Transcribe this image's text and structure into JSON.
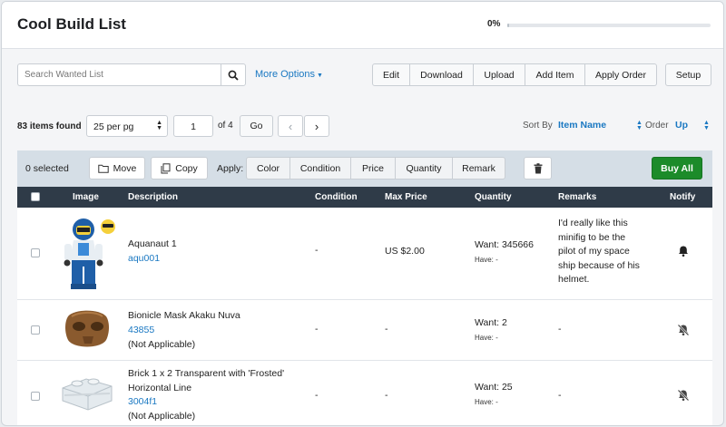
{
  "header": {
    "title": "Cool Build List",
    "progress_text": "0%",
    "progress": 0
  },
  "toolbar": {
    "search_placeholder": "Search Wanted List",
    "search_icon": "magnifier-icon",
    "more_options": "More Options",
    "buttons": [
      "Edit",
      "Download",
      "Upload",
      "Add Item",
      "Apply Order"
    ],
    "setup": "Setup"
  },
  "list": {
    "items_found": "83 items found",
    "per_page": "25 per pg",
    "page": "1",
    "of_pages": "of 4",
    "go": "Go",
    "sort_by_label": "Sort By",
    "sort_by_value": "Item Name",
    "order_label": "Order",
    "order_value": "Up"
  },
  "actions": {
    "selected": "0 selected",
    "move": "Move",
    "copy": "Copy",
    "apply_label": "Apply:",
    "apply_buttons": [
      "Color",
      "Condition",
      "Price",
      "Quantity",
      "Remark"
    ],
    "buy_all": "Buy All",
    "buy_all_color": "#1c8b2a"
  },
  "table": {
    "headers": {
      "image": "Image",
      "description": "Description",
      "condition": "Condition",
      "max_price": "Max Price",
      "quantity": "Quantity",
      "remarks": "Remarks",
      "notify": "Notify"
    },
    "rows": [
      {
        "name": "Aquanaut 1",
        "item_no": "aqu001",
        "sub": "",
        "condition": "-",
        "max_price": "US $2.00",
        "want": "Want: 345666",
        "have": "Have: -",
        "remarks": [
          "I'd really like this",
          "minifig to be the",
          "pilot of my space",
          "ship because of his",
          "helmet."
        ],
        "notify": "bell-on-icon"
      },
      {
        "name": "Bionicle Mask Akaku Nuva",
        "item_no": "43855",
        "sub": "(Not Applicable)",
        "condition": "-",
        "max_price": "-",
        "want": "Want: 2",
        "have": "Have: -",
        "remarks": [
          "-"
        ],
        "notify": "bell-off-icon"
      },
      {
        "name_lines": [
          "Brick 1 x 2 Transparent with 'Frosted'",
          "Horizontal Line"
        ],
        "item_no": "3004f1",
        "sub": "(Not Applicable)",
        "condition": "-",
        "max_price": "-",
        "want": "Want: 25",
        "have": "Have: -",
        "remarks": [
          "-"
        ],
        "notify": "bell-off-icon"
      }
    ]
  }
}
